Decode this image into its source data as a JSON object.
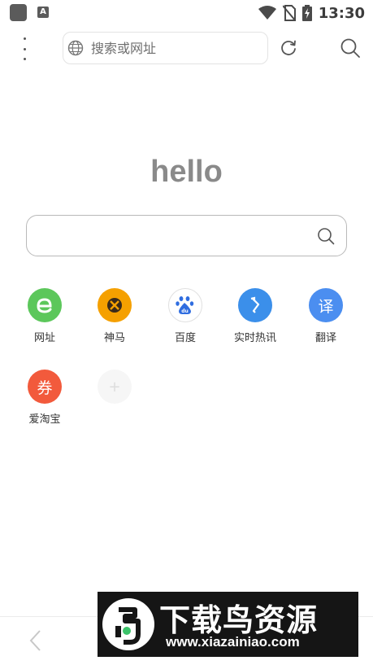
{
  "status_bar": {
    "time": "13:30",
    "icons": [
      "app-square-icon",
      "a-badge-icon",
      "wifi-icon",
      "no-sim-icon",
      "battery-charging-icon"
    ]
  },
  "toolbar": {
    "address_placeholder": "搜索或网址",
    "menu_icon": "more-vertical-icon",
    "refresh_icon": "refresh-icon",
    "search_icon": "search-icon"
  },
  "logo": {
    "text": "hello"
  },
  "main_search": {
    "value": "",
    "icon": "search-icon"
  },
  "shortcuts": [
    {
      "label": "网址",
      "glyph": "e",
      "color": "#5cc75b"
    },
    {
      "label": "神马",
      "glyph": "",
      "color": "#f5a000"
    },
    {
      "label": "百度",
      "glyph": "du",
      "color": "#ffffff"
    },
    {
      "label": "实时热讯",
      "glyph": "",
      "color": "#3b8fea"
    },
    {
      "label": "翻译",
      "glyph": "译",
      "color": "#4b8ef0"
    },
    {
      "label": "爱淘宝",
      "glyph": "券",
      "color": "#f25a3c"
    },
    {
      "label": "",
      "glyph": "+",
      "color": "#f6f6f6"
    }
  ],
  "bottom_bar": {
    "back_icon": "chevron-left-icon"
  },
  "watermark": {
    "title": "下载鸟资源",
    "url": "www.xiazainiao.com"
  }
}
